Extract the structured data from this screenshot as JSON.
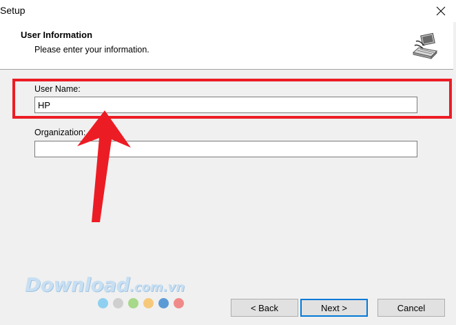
{
  "window": {
    "title": "Setup"
  },
  "header": {
    "title": "User Information",
    "subtitle": "Please enter your information."
  },
  "form": {
    "user_name_label": "User Name:",
    "user_name_value": "HP",
    "organization_label": "Organization:",
    "organization_value": ""
  },
  "buttons": {
    "back_label": "< Back",
    "next_label": "Next >",
    "cancel_label": "Cancel"
  },
  "watermark": {
    "brand": "Download",
    "domain": ".com.vn",
    "dot_colors": [
      "#8fd0f0",
      "#cfcfcf",
      "#a8d88a",
      "#f6c97a",
      "#5b9bd5",
      "#f08a8a"
    ]
  },
  "annotation": {
    "highlight_color": "#ec1c24",
    "arrow_color": "#ec1c24"
  }
}
